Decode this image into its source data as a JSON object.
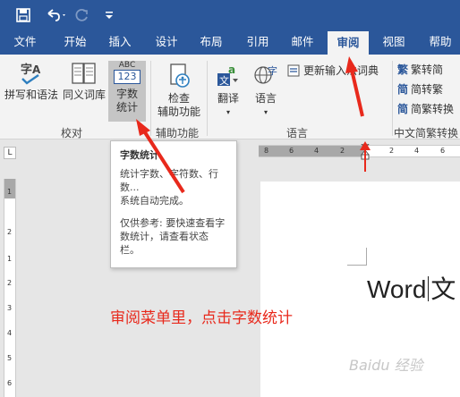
{
  "quick_access": {
    "save_icon": "save-icon",
    "undo_icon": "undo-icon",
    "redo_icon": "redo-icon",
    "customize_icon": "customize-qat-icon"
  },
  "tabs": [
    {
      "label": "文件"
    },
    {
      "label": "开始"
    },
    {
      "label": "插入"
    },
    {
      "label": "设计"
    },
    {
      "label": "布局"
    },
    {
      "label": "引用"
    },
    {
      "label": "邮件"
    },
    {
      "label": "审阅"
    },
    {
      "label": "视图"
    },
    {
      "label": "帮助"
    }
  ],
  "ribbon": {
    "spelling_label": "拼写和语法",
    "thesaurus_label": "同义词库",
    "wordcount_icon_text": "ABC",
    "wordcount_icon_num": "123",
    "wordcount_label_1": "字数",
    "wordcount_label_2": "统计",
    "group_proofing": "校对",
    "accessibility_label_1": "检查",
    "accessibility_label_2": "辅助功能",
    "group_accessibility": "辅助功能",
    "translate_label": "翻译",
    "language_label": "语言",
    "update_ime_label": "更新输入法词典",
    "group_language": "语言",
    "to_traditional": "繁转简",
    "to_simplified": "简转繁",
    "convert_label": "简繁转换",
    "group_chinese": "中文简繁转换"
  },
  "tooltip": {
    "title": "字数统计",
    "line1": "统计字数、字符数、行数...",
    "line2": "系统自动完成。",
    "line3": "仅供参考: 要快速查看字数统计，请查看状态栏。"
  },
  "ruler": {
    "h_numbers": [
      "8",
      "6",
      "4",
      "2",
      "2",
      "4",
      "6"
    ],
    "v_numbers": [
      "1",
      "2",
      "1",
      "2",
      "3",
      "4",
      "5",
      "6"
    ]
  },
  "document": {
    "text_before": "Word",
    "text_after": "文"
  },
  "annotation": "审阅菜单里，点击字数统计",
  "watermark": "Baidu 经验",
  "colors": {
    "accent": "#2b579a",
    "annotation": "#e8291c"
  }
}
